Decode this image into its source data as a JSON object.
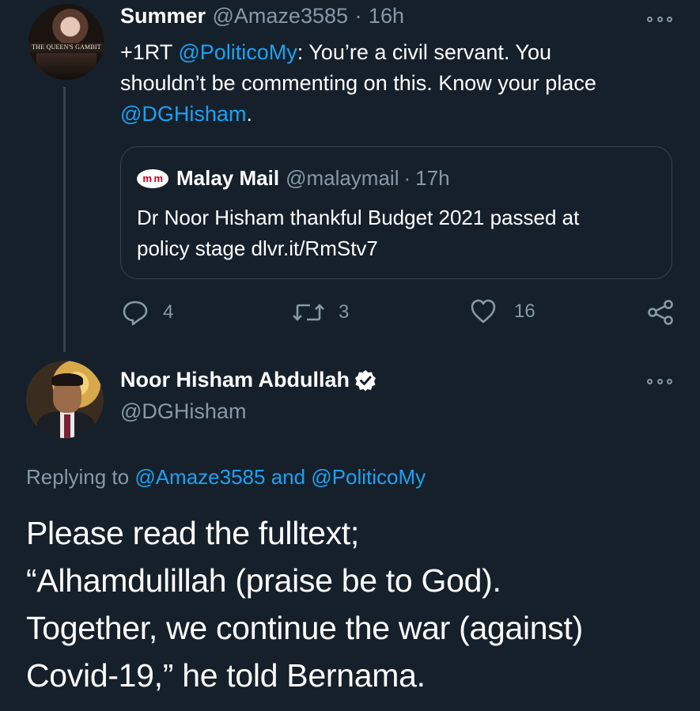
{
  "tweet1": {
    "avatar_caption": "THE QUEEN'S GAMBIT",
    "name": "Summer",
    "handle": "@Amaze3585",
    "separator": "·",
    "time": "16h",
    "text_prefix": "+1RT ",
    "mention1": "@PoliticoMy",
    "text_line1_rest": ": You’re a civil servant. You",
    "text_line2": "shouldn’t be commenting on this. Know your place",
    "mention2": "@DGHisham",
    "text_end": ".",
    "quote": {
      "logo": "m m",
      "name": "Malay Mail",
      "handle": "@malaymail",
      "separator": "·",
      "time": "17h",
      "line1": "Dr Noor Hisham thankful Budget 2021 passed at",
      "line2": "policy stage dlvr.it/RmStv7"
    },
    "actions": {
      "replies": "4",
      "retweets": "3",
      "likes": "16"
    }
  },
  "tweet2": {
    "name": "Noor Hisham Abdullah",
    "handle": "@DGHisham",
    "replying_prefix": "Replying to ",
    "replying_user1": "@Amaze3585",
    "replying_and": " and ",
    "replying_user2": "@PoliticoMy",
    "text_lines": [
      "Please read the fulltext;",
      "“Alhamdulillah (praise be to God).",
      "Together, we continue the war (against)",
      "Covid-19,” he told Bernama."
    ]
  },
  "colors": {
    "background": "#15202b",
    "link": "#1da1f2",
    "secondary": "#8899a6",
    "border": "#38444d"
  }
}
